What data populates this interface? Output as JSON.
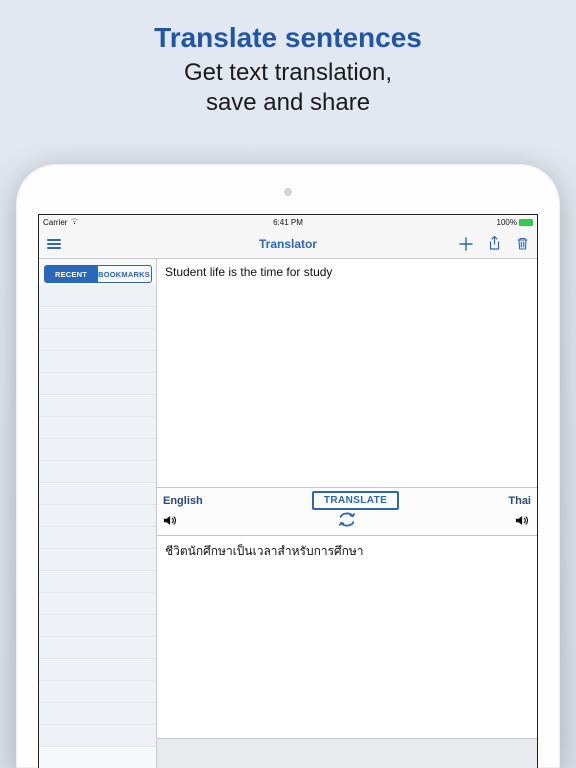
{
  "promo": {
    "title": "Translate sentences",
    "line1": "Get text translation,",
    "line2": "save and share"
  },
  "statusbar": {
    "carrier": "Carrier",
    "time": "6:41 PM",
    "battery": "100%"
  },
  "navbar": {
    "title": "Translator"
  },
  "sidebar": {
    "tabs": {
      "recent": "RECENT",
      "bookmarks": "BOOKMARKS"
    }
  },
  "translator": {
    "input_text": "Student life is the time for study",
    "source_lang": "English",
    "target_lang": "Thai",
    "translate_label": "TRANSLATE",
    "output_text": "ชีวิตนักศึกษาเป็นเวลาสำหรับการศึกษา"
  }
}
